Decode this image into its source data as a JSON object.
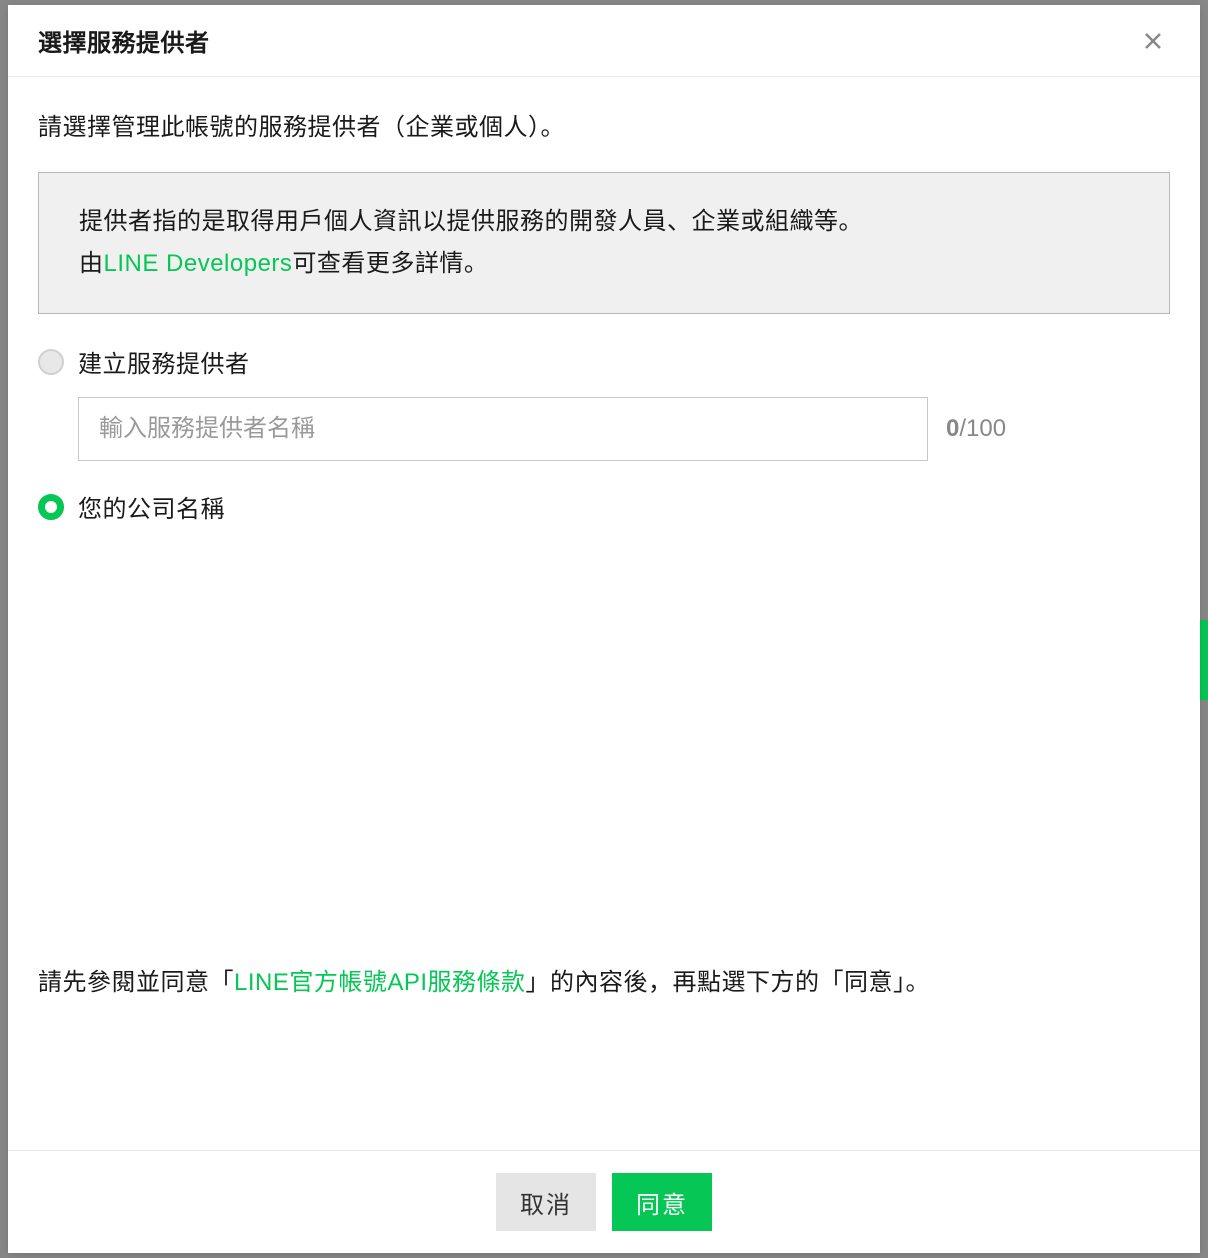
{
  "modal": {
    "title": "選擇服務提供者",
    "intro": "請選擇管理此帳號的服務提供者（企業或個人）。",
    "info_box": {
      "line1": "提供者指的是取得用戶個人資訊以提供服務的開發人員、企業或組織等。",
      "line2_prefix": "由",
      "line2_link": "LINE Developers",
      "line2_suffix": "可查看更多詳情。"
    },
    "options": {
      "create": {
        "label": "建立服務提供者",
        "placeholder": "輸入服務提供者名稱",
        "count": "0",
        "max": "/100"
      },
      "existing": {
        "label": "您的公司名稱"
      }
    },
    "agreement": {
      "prefix": "請先參閱並同意「",
      "link": "LINE官方帳號API服務條款",
      "suffix": "」的內容後，再點選下方的「同意」。"
    },
    "buttons": {
      "cancel": "取消",
      "agree": "同意"
    }
  }
}
